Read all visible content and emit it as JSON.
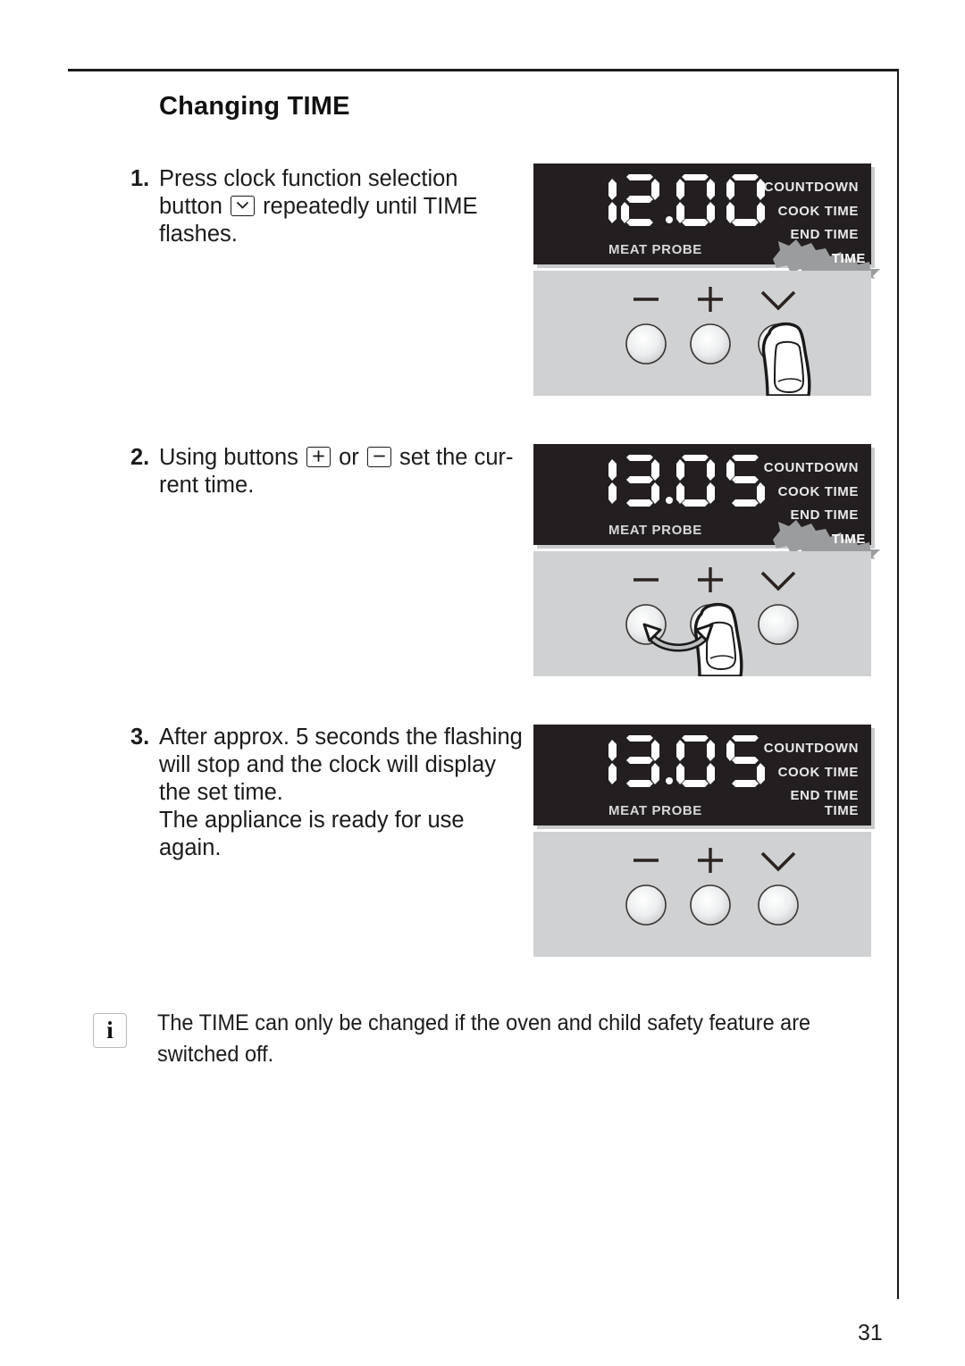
{
  "page": {
    "title": "Changing TIME",
    "number": "31"
  },
  "steps": [
    {
      "number": "1.",
      "text_before_key": "Press clock function selection button ",
      "key_icon": "chevron-down-key",
      "text_after_key": " repeatedly until TIME flashes.",
      "extra": ""
    },
    {
      "number": "2.",
      "text_before_key": "Using buttons ",
      "key_icon": "plus-key",
      "text_mid": " or ",
      "key_icon_2": "minus-key",
      "text_after_key": " set the cur­rent time.",
      "extra": ""
    },
    {
      "number": "3.",
      "text_before_key": "After approx. 5 seconds the flashing will stop and the clock will display the set time.",
      "extra": "The appliance is ready for use again."
    }
  ],
  "panels": [
    {
      "name": "panel-step-1",
      "display_value": "12.00",
      "labels": [
        "COUNTDOWN",
        "COOK TIME",
        "END TIME"
      ],
      "meat_probe_label": "MEAT PROBE",
      "time_label": "TIME",
      "time_flashing": true,
      "buttons": [
        "minus",
        "plus",
        "chevron-down"
      ],
      "finger_on": "chevron-down",
      "arrow": false
    },
    {
      "name": "panel-step-2",
      "display_value": "13.05",
      "labels": [
        "COUNTDOWN",
        "COOK TIME",
        "END TIME"
      ],
      "meat_probe_label": "MEAT PROBE",
      "time_label": "TIME",
      "time_flashing": true,
      "buttons": [
        "minus",
        "plus",
        "chevron-down"
      ],
      "finger_on": "plus",
      "arrow": true
    },
    {
      "name": "panel-step-3",
      "display_value": "13.05",
      "labels": [
        "COUNTDOWN",
        "COOK TIME",
        "END TIME"
      ],
      "meat_probe_label": "MEAT PROBE",
      "time_label": "TIME",
      "time_flashing": false,
      "buttons": [
        "minus",
        "plus",
        "chevron-down"
      ],
      "finger_on": null,
      "arrow": false
    }
  ],
  "note": {
    "icon": "info-icon",
    "icon_glyph": "i",
    "text": "The TIME can only be changed if the oven and child safety feature are switched off."
  },
  "colors": {
    "display_background": "#231f20",
    "panel_background": "#cfd1d3",
    "display_text": "#ffffff",
    "flash_fill": "#9a9c9e",
    "text": "#1b1b1b"
  }
}
